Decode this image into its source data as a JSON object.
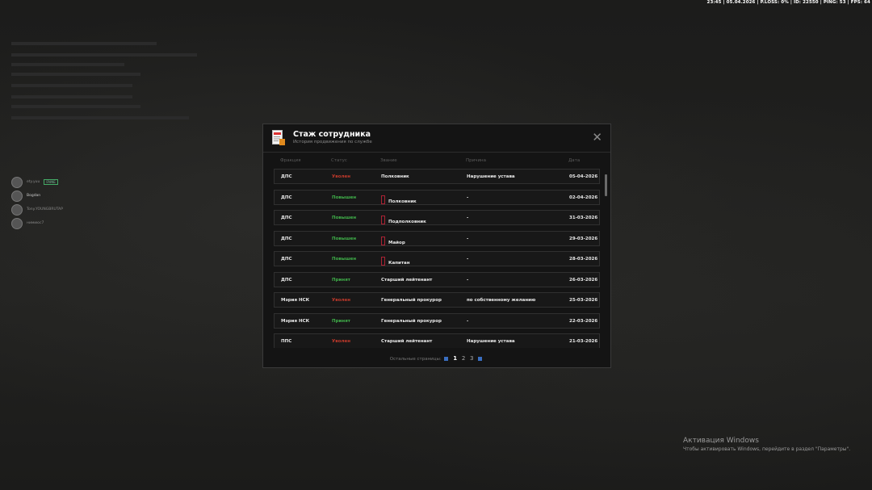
{
  "hud": {
    "text": "23:45 | 05.04.2026 | P.LOSS: 0% | ID: 22550 | PING: 53 | FPS: 64"
  },
  "players": [
    {
      "name": "ety.yuu",
      "tag": "FAINE"
    },
    {
      "name": "Bogdan",
      "tag": ""
    },
    {
      "name": "Tony.YOUNGBRUTAP",
      "tag": ""
    },
    {
      "name": "нимиюс7",
      "tag": ""
    }
  ],
  "windows": {
    "title": "Активация Windows",
    "subtitle": "Чтобы активировать Windows, перейдите в раздел \"Параметры\"."
  },
  "modal": {
    "title": "Стаж сотрудника",
    "subtitle": "История продвижения по службе",
    "close_icon": "close-icon",
    "columns": [
      "Фракция",
      "Статус",
      "Звание",
      "Причина",
      "Дата"
    ],
    "rows": [
      {
        "faction": "ДПС",
        "status": "Уволен",
        "status_color": "#c0392b",
        "rank": "Полковник",
        "rank_icon": false,
        "reason": "Нарушение устава",
        "date": "05-04-2026"
      },
      {
        "faction": "ДПС",
        "status": "Повышен",
        "status_color": "#3fae49",
        "rank": "Полковник",
        "rank_icon": true,
        "reason": "-",
        "date": "02-04-2026"
      },
      {
        "faction": "ДПС",
        "status": "Повышен",
        "status_color": "#3fae49",
        "rank": "Подполковник",
        "rank_icon": true,
        "reason": "-",
        "date": "31-03-2026"
      },
      {
        "faction": "ДПС",
        "status": "Повышен",
        "status_color": "#3fae49",
        "rank": "Майор",
        "rank_icon": true,
        "reason": "-",
        "date": "29-03-2026"
      },
      {
        "faction": "ДПС",
        "status": "Повышен",
        "status_color": "#3fae49",
        "rank": "Капитан",
        "rank_icon": true,
        "reason": "-",
        "date": "28-03-2026"
      },
      {
        "faction": "ДПС",
        "status": "Принят",
        "status_color": "#3fae49",
        "rank": "Старший лейтенант",
        "rank_icon": false,
        "reason": "-",
        "date": "26-03-2026"
      },
      {
        "faction": "Мэрия НСК",
        "status": "Уволен",
        "status_color": "#c0392b",
        "rank": "Генеральный прокурор",
        "rank_icon": false,
        "reason": "по собственному желанию",
        "date": "25-03-2026"
      },
      {
        "faction": "Мэрия НСК",
        "status": "Принят",
        "status_color": "#3fae49",
        "rank": "Генеральный прокурор",
        "rank_icon": false,
        "reason": "-",
        "date": "22-03-2026"
      },
      {
        "faction": "ППС",
        "status": "Уволен",
        "status_color": "#c0392b",
        "rank": "Старший лейтенант",
        "rank_icon": false,
        "reason": "Нарушение устава",
        "date": "21-03-2026"
      }
    ],
    "pager": {
      "label": "Остальные страницы:",
      "pages": [
        "1",
        "2",
        "3"
      ],
      "current": "1"
    }
  }
}
